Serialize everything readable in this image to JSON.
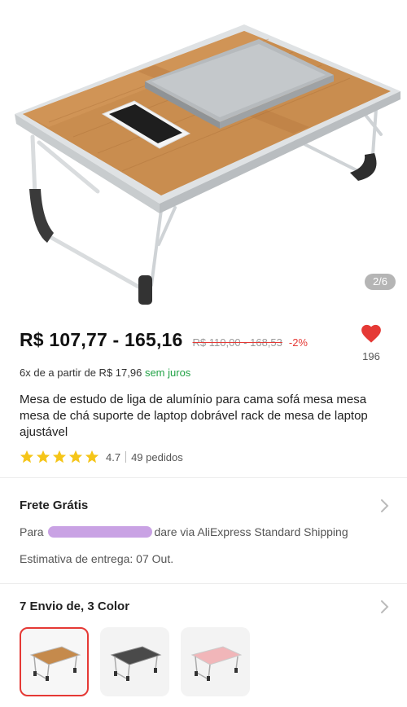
{
  "gallery": {
    "counter": "2/6"
  },
  "price": {
    "range": "R$ 107,77 - 165,16",
    "original": "R$ 110,00 - 168,53",
    "discount": "-2%"
  },
  "wishlist": {
    "count": "196"
  },
  "installments": {
    "text": "6x de a partir de R$ 17,96",
    "interest": "sem juros"
  },
  "product": {
    "title": "Mesa de estudo de liga de alumínio para cama sofá mesa mesa mesa de chá suporte de laptop dobrável rack de mesa de laptop ajustável"
  },
  "rating": {
    "score": "4.7",
    "orders": "49 pedidos",
    "stars": 5
  },
  "shipping": {
    "title": "Frete Grátis",
    "to_prefix": "Para",
    "to_suffix": "dare via AliExpress Standard Shipping",
    "estimate": "Estimativa de entrega: 07 Out."
  },
  "variants": {
    "title": "7 Envio de, 3 Color",
    "items": [
      {
        "name": "wood",
        "color": "#c58a4c",
        "selected": true
      },
      {
        "name": "black",
        "color": "#4a4a4a",
        "selected": false
      },
      {
        "name": "pink",
        "color": "#f1b6b9",
        "selected": false
      }
    ]
  },
  "colors": {
    "accent": "#e53935",
    "green": "#23a347",
    "heart": "#e53935"
  }
}
